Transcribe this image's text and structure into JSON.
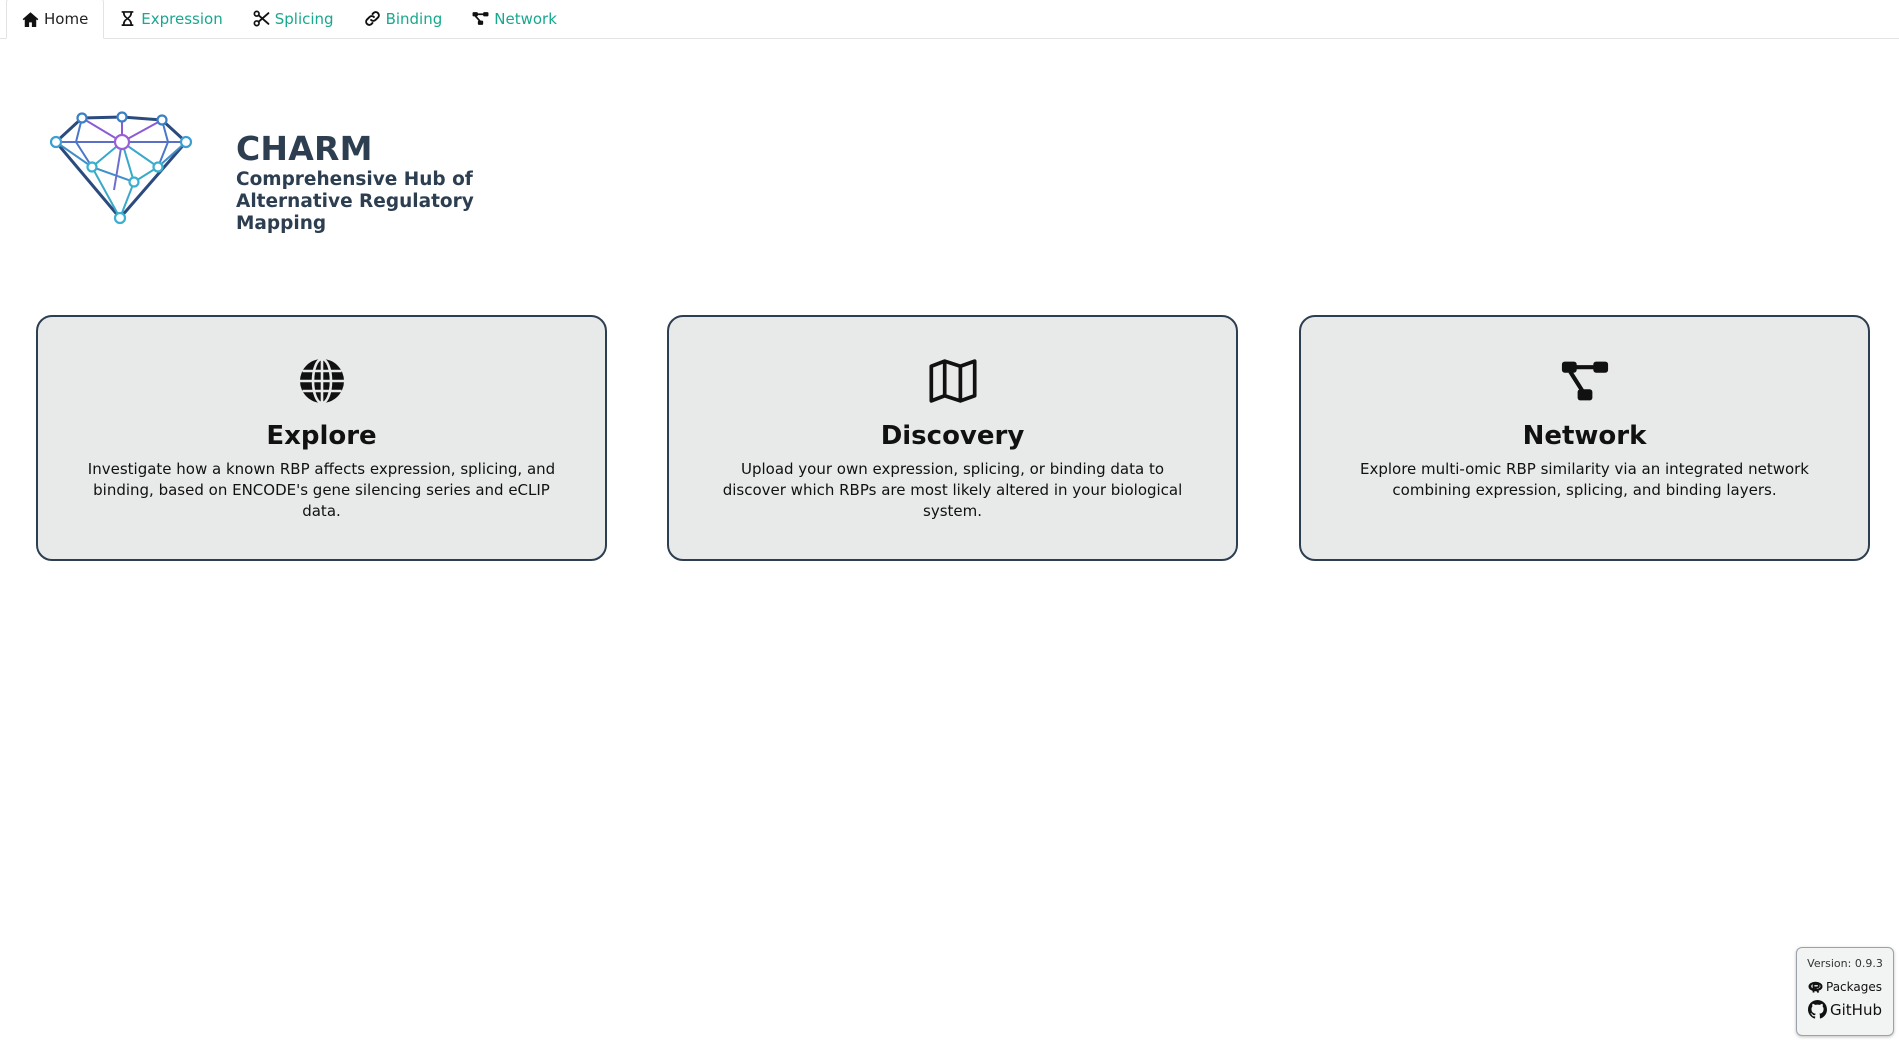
{
  "nav": {
    "items": [
      {
        "label": "Home",
        "icon": "home-icon",
        "active": true
      },
      {
        "label": "Expression",
        "icon": "hourglass-icon",
        "active": false
      },
      {
        "label": "Splicing",
        "icon": "scissors-icon",
        "active": false
      },
      {
        "label": "Binding",
        "icon": "link-icon",
        "active": false
      },
      {
        "label": "Network",
        "icon": "network-icon",
        "active": false
      }
    ]
  },
  "header": {
    "title": "CHARM",
    "subtitle": "Comprehensive Hub of Alternative Regulatory Mapping"
  },
  "cards": [
    {
      "title": "Explore",
      "icon": "globe-icon",
      "description": "Investigate how a known RBP affects expression, splicing, and binding, based on ENCODE's gene silencing series and eCLIP data."
    },
    {
      "title": "Discovery",
      "icon": "map-icon",
      "description": "Upload your own expression, splicing, or binding data to discover which RBPs are most likely altered in your biological system."
    },
    {
      "title": "Network",
      "icon": "network-icon",
      "description": "Explore multi-omic RBP similarity via an integrated network combining expression, splicing, and binding layers."
    }
  ],
  "footer": {
    "version": "Version: 0.9.3",
    "packages_label": "Packages",
    "github_label": "GitHub"
  },
  "colors": {
    "accent": "#18a88f",
    "title": "#2c3e50",
    "card_bg": "#e8e9e9",
    "card_border": "#2c3e50"
  }
}
